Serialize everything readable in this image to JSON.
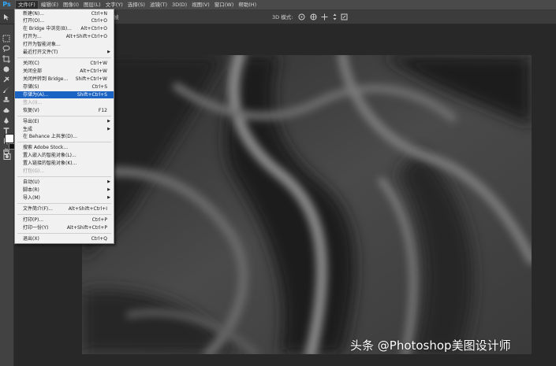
{
  "app": {
    "logo": "Ps"
  },
  "menubar": {
    "items": [
      "文件(F)",
      "编辑(E)",
      "图像(I)",
      "图层(L)",
      "文字(Y)",
      "选择(S)",
      "滤镜(T)",
      "3D(D)",
      "视图(V)",
      "窗口(W)",
      "帮助(H)"
    ]
  },
  "options_bar": {
    "frame_label": "帧",
    "mode_label": "3D 模式:"
  },
  "file_menu": {
    "items": [
      {
        "label": "新建(N)...",
        "shortcut": "Ctrl+N"
      },
      {
        "label": "打开(O)...",
        "shortcut": "Ctrl+O"
      },
      {
        "label": "在 Bridge 中浏览(B)...",
        "shortcut": "Alt+Ctrl+O"
      },
      {
        "label": "打开为...",
        "shortcut": "Alt+Shift+Ctrl+O"
      },
      {
        "label": "打开为智能对象...",
        "shortcut": ""
      },
      {
        "label": "最近打开文件(T)",
        "shortcut": ""
      },
      {
        "label": "关闭(C)",
        "shortcut": "Ctrl+W"
      },
      {
        "label": "关闭全部",
        "shortcut": "Alt+Ctrl+W"
      },
      {
        "label": "关闭并转到 Bridge...",
        "shortcut": "Shift+Ctrl+W"
      },
      {
        "label": "存储(S)",
        "shortcut": "Ctrl+S"
      },
      {
        "label": "存储为(A)...",
        "shortcut": "Shift+Ctrl+S"
      },
      {
        "label": "签入(I)...",
        "shortcut": ""
      },
      {
        "label": "恢复(V)",
        "shortcut": "F12"
      },
      {
        "label": "导出(E)",
        "shortcut": ""
      },
      {
        "label": "生成",
        "shortcut": ""
      },
      {
        "label": "在 Behance 上共享(D)...",
        "shortcut": ""
      },
      {
        "label": "搜索 Adobe Stock...",
        "shortcut": ""
      },
      {
        "label": "置入嵌入的智能对象(L)...",
        "shortcut": ""
      },
      {
        "label": "置入链接的智能对象(K)...",
        "shortcut": ""
      },
      {
        "label": "打包(G)...",
        "shortcut": ""
      },
      {
        "label": "自动(U)",
        "shortcut": ""
      },
      {
        "label": "脚本(R)",
        "shortcut": ""
      },
      {
        "label": "导入(M)",
        "shortcut": ""
      },
      {
        "label": "文件简介(F)...",
        "shortcut": "Alt+Shift+Ctrl+I"
      },
      {
        "label": "打印(P)...",
        "shortcut": "Ctrl+P"
      },
      {
        "label": "打印一份(Y)",
        "shortcut": "Alt+Shift+Ctrl+P"
      },
      {
        "label": "退出(X)",
        "shortcut": "Ctrl+Q"
      }
    ]
  },
  "watermark": "头条 @Photoshop美图设计师",
  "colors": {
    "accent": "#1b63c3",
    "ps_blue": "#31a8ff"
  }
}
